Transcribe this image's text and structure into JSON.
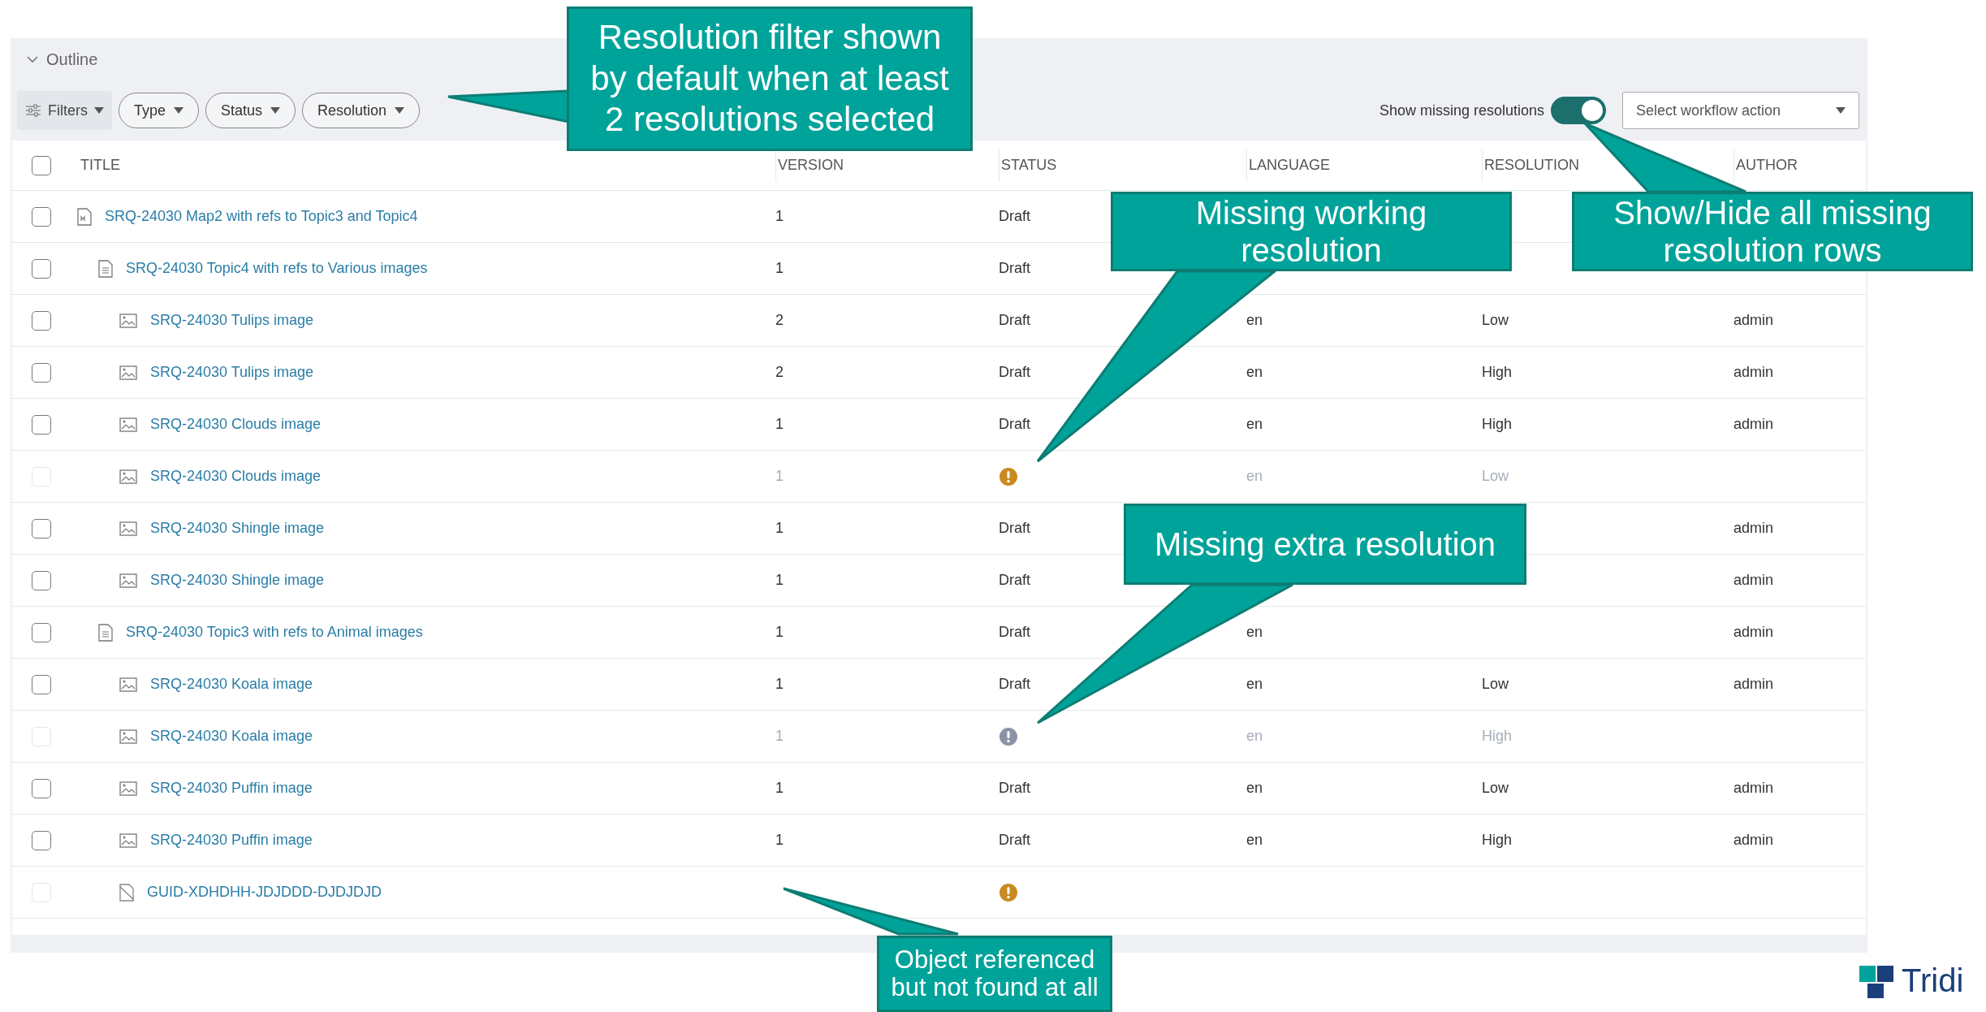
{
  "outline": {
    "label": "Outline",
    "expanded": true
  },
  "filters": [
    {
      "kind": "menu",
      "label": "Filters"
    },
    {
      "kind": "pill",
      "label": "Type"
    },
    {
      "kind": "pill",
      "label": "Status"
    },
    {
      "kind": "pill",
      "label": "Resolution"
    }
  ],
  "missing_toggle": {
    "label": "Show missing resolutions",
    "on": true
  },
  "workflow_select": {
    "placeholder": "Select workflow action"
  },
  "table": {
    "select_all": {
      "checked": false
    },
    "columns": [
      "TITLE",
      "VERSION",
      "STATUS",
      "LANGUAGE",
      "RESOLUTION",
      "AUTHOR"
    ],
    "rows": [
      {
        "kind": "map",
        "title": "SRQ-24030 Map2 with refs to Topic3 and Topic4",
        "version": "1",
        "status": "Draft",
        "checked": false,
        "disabled": false,
        "children": [
          {
            "kind": "topic",
            "title": "SRQ-24030 Topic4 with refs to Various images",
            "version": "1",
            "status": "Draft",
            "checked": false,
            "disabled": false,
            "children": [
              {
                "kind": "image",
                "title": "SRQ-24030 Tulips image",
                "version": "2",
                "status": "Draft",
                "language": "en",
                "resolution": "Low",
                "author": "admin",
                "checked": false,
                "disabled": false
              },
              {
                "kind": "image",
                "title": "SRQ-24030 Tulips image",
                "version": "2",
                "status": "Draft",
                "language": "en",
                "resolution": "High",
                "author": "admin",
                "checked": false,
                "disabled": false
              },
              {
                "kind": "image",
                "title": "SRQ-24030 Clouds image",
                "version": "1",
                "status": "Draft",
                "language": "en",
                "resolution": "High",
                "author": "admin",
                "checked": false,
                "disabled": false
              },
              {
                "kind": "image",
                "title": "SRQ-24030 Clouds image",
                "version": "1",
                "color": "#c98a1f",
                "language": "en",
                "resolution": "Low",
                "checked": false,
                "disabled": true
              },
              {
                "kind": "image",
                "title": "SRQ-24030 Shingle image",
                "version": "1",
                "status": "Draft",
                "author": "admin",
                "checked": false,
                "disabled": false
              },
              {
                "kind": "image",
                "title": "SRQ-24030 Shingle image",
                "version": "1",
                "status": "Draft",
                "author": "admin",
                "checked": false,
                "disabled": false
              }
            ]
          },
          {
            "kind": "topic",
            "title": "SRQ-24030 Topic3 with refs to Animal images",
            "version": "1",
            "status": "Draft",
            "language": "en",
            "author": "admin",
            "checked": false,
            "disabled": false,
            "children": [
              {
                "kind": "image",
                "title": "SRQ-24030 Koala image",
                "version": "1",
                "status": "Draft",
                "language": "en",
                "resolution": "Low",
                "author": "admin",
                "checked": false,
                "disabled": false
              },
              {
                "kind": "image",
                "title": "SRQ-24030 Koala image",
                "version": "1",
                "color": "#8a93a6",
                "language": "en",
                "resolution": "High",
                "checked": false,
                "disabled": true
              },
              {
                "kind": "image",
                "title": "SRQ-24030 Puffin image",
                "version": "1",
                "status": "Draft",
                "language": "en",
                "resolution": "Low",
                "author": "admin",
                "checked": false,
                "disabled": false
              },
              {
                "kind": "image",
                "title": "SRQ-24030 Puffin image",
                "version": "1",
                "status": "Draft",
                "language": "en",
                "resolution": "High",
                "author": "admin",
                "checked": false,
                "disabled": false
              },
              {
                "kind": "unknown",
                "title": "GUID-XDHDHH-JDJDDD-DJDJDJD",
                "color": "#c98a1f",
                "checked": false,
                "disabled": true
              }
            ]
          }
        ]
      }
    ]
  },
  "callouts": [
    "Resolution filter shown by default when at least 2 resolutions selected",
    "Missing working resolution",
    "Show/Hide all missing resolution rows",
    "Missing extra resolution",
    "Object referenced but not found at all"
  ],
  "logo": {
    "text": "Tridi"
  }
}
